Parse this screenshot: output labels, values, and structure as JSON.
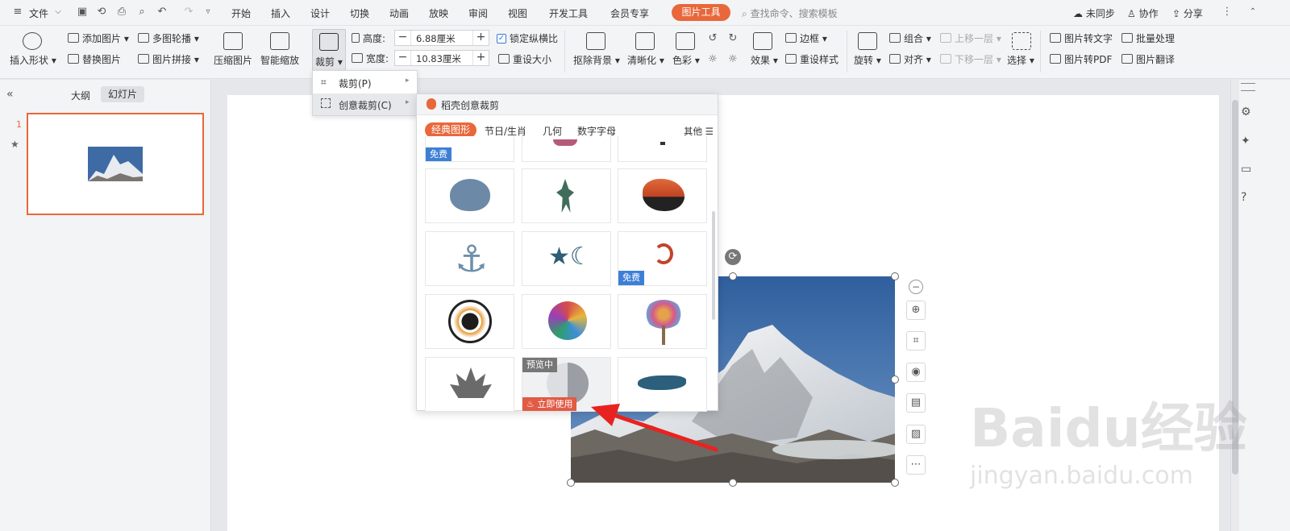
{
  "menubar": {
    "file_label": "文件",
    "tabs": [
      "开始",
      "插入",
      "设计",
      "切换",
      "动画",
      "放映",
      "审阅",
      "视图",
      "开发工具",
      "会员专享"
    ],
    "active_tab": "图片工具",
    "search_placeholder": "查找命令、搜索模板",
    "sync_label": "未同步",
    "collab_label": "协作",
    "share_label": "分享"
  },
  "ribbon": {
    "insert_shape": "插入形状",
    "add_picture": "添加图片",
    "replace_picture": "替换图片",
    "multi_carousel": "多图轮播",
    "picture_splice": "图片拼接",
    "compress_picture": "压缩图片",
    "smart_zoom": "智能缩放",
    "crop": "裁剪",
    "height_label": "高度:",
    "height_value": "6.88厘米",
    "width_label": "宽度:",
    "width_value": "10.83厘米",
    "lock_ratio": "锁定纵横比",
    "reset_size": "重设大小",
    "remove_bg": "抠除背景",
    "sharpen": "清晰化",
    "color": "色彩",
    "effects": "效果",
    "border": "边框",
    "reset_style": "重设样式",
    "rotate": "旋转",
    "group": "组合",
    "align": "对齐",
    "bring_forward": "上移一层",
    "send_backward": "下移一层",
    "select": "选择",
    "pic_to_text": "图片转文字",
    "pic_to_pdf": "图片转PDF",
    "batch": "批量处理",
    "pic_translate": "图片翻译"
  },
  "panel": {
    "outline_tab": "大纲",
    "slides_tab": "幻灯片",
    "slide_number": "1"
  },
  "dropdown": {
    "crop_item": "裁剪(P)",
    "creative_item": "创意裁剪(C)"
  },
  "gallery": {
    "header": "稻壳创意裁剪",
    "tabs": [
      "经典图形",
      "节日/生肖",
      "几何",
      "数字字母"
    ],
    "other": "其他",
    "free_tag": "免费",
    "preview_tag": "预览中",
    "use_now": "立即使用"
  },
  "watermark": {
    "brand": "Baidu经验",
    "url": "jingyan.baidu.com"
  },
  "colors": {
    "accent": "#e8683b",
    "tag_blue": "#3d7fd6",
    "arrow_red": "#e8231f"
  }
}
